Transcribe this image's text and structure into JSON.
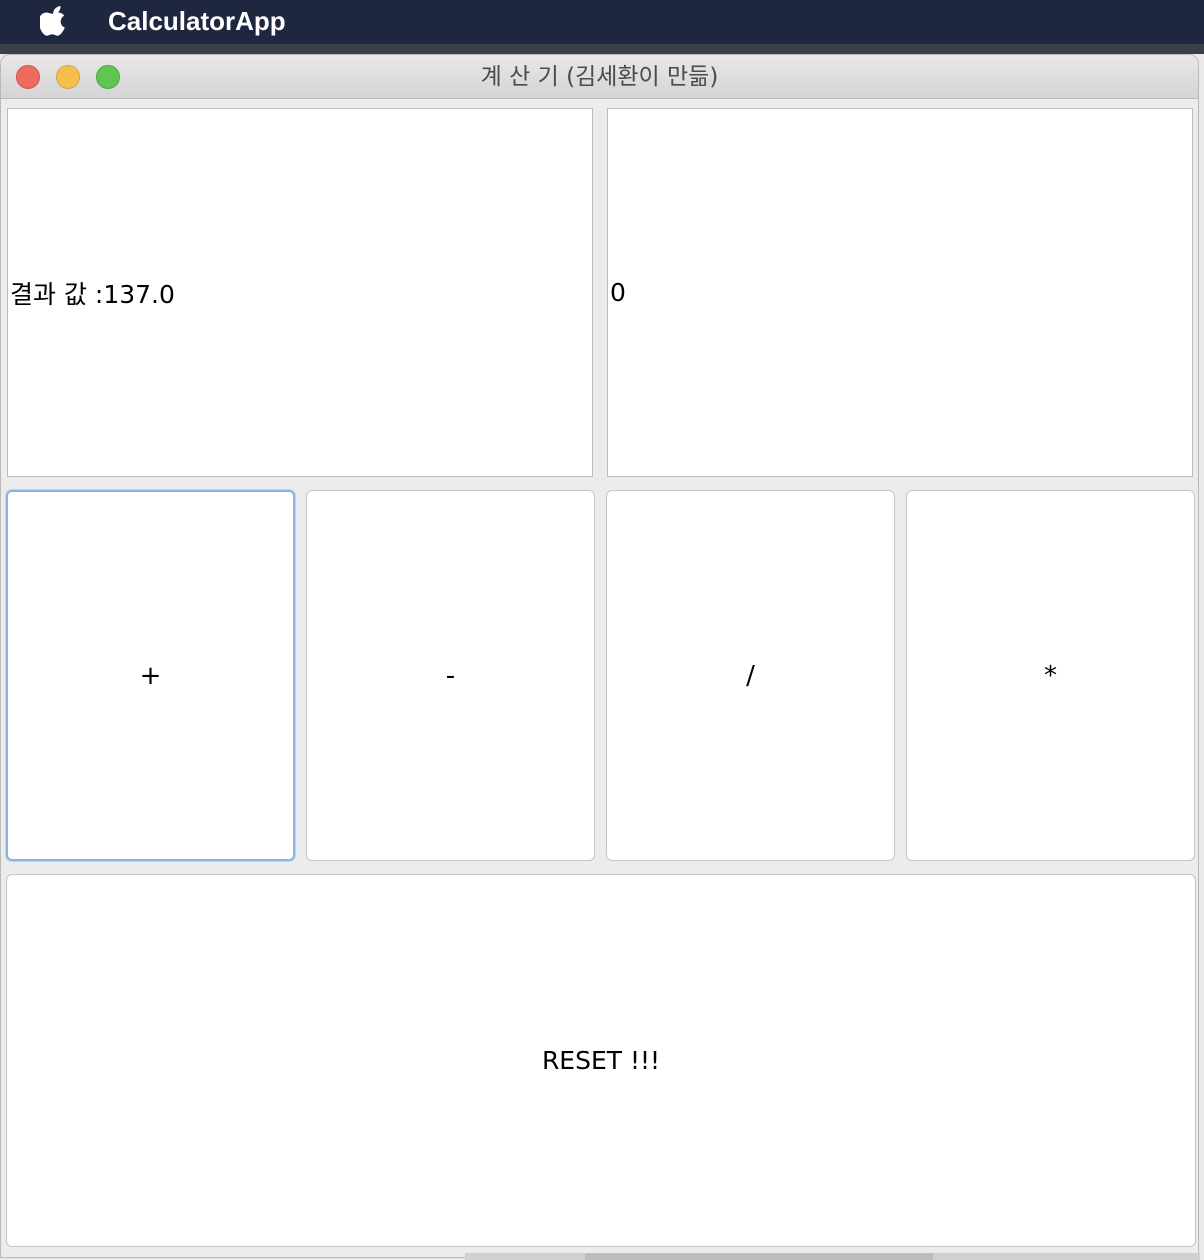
{
  "menubar": {
    "apple_icon": "apple-logo-icon",
    "app_name": "CalculatorApp"
  },
  "window": {
    "title": "계 산 기 (김세환이 만듦)",
    "controls": [
      "close",
      "minimize",
      "zoom"
    ]
  },
  "display": {
    "result_text": "결과 값 :137.0",
    "input_value": "0"
  },
  "operators": {
    "plus": "+",
    "minus": "-",
    "divide": "/",
    "multiply": "*"
  },
  "reset_label": "RESET !!!",
  "colors": {
    "menubar": "#1f2740",
    "close": "#ed6a5e",
    "minimize": "#f5bf4f",
    "zoom": "#61c554",
    "focus_ring": "#87b4e6"
  }
}
